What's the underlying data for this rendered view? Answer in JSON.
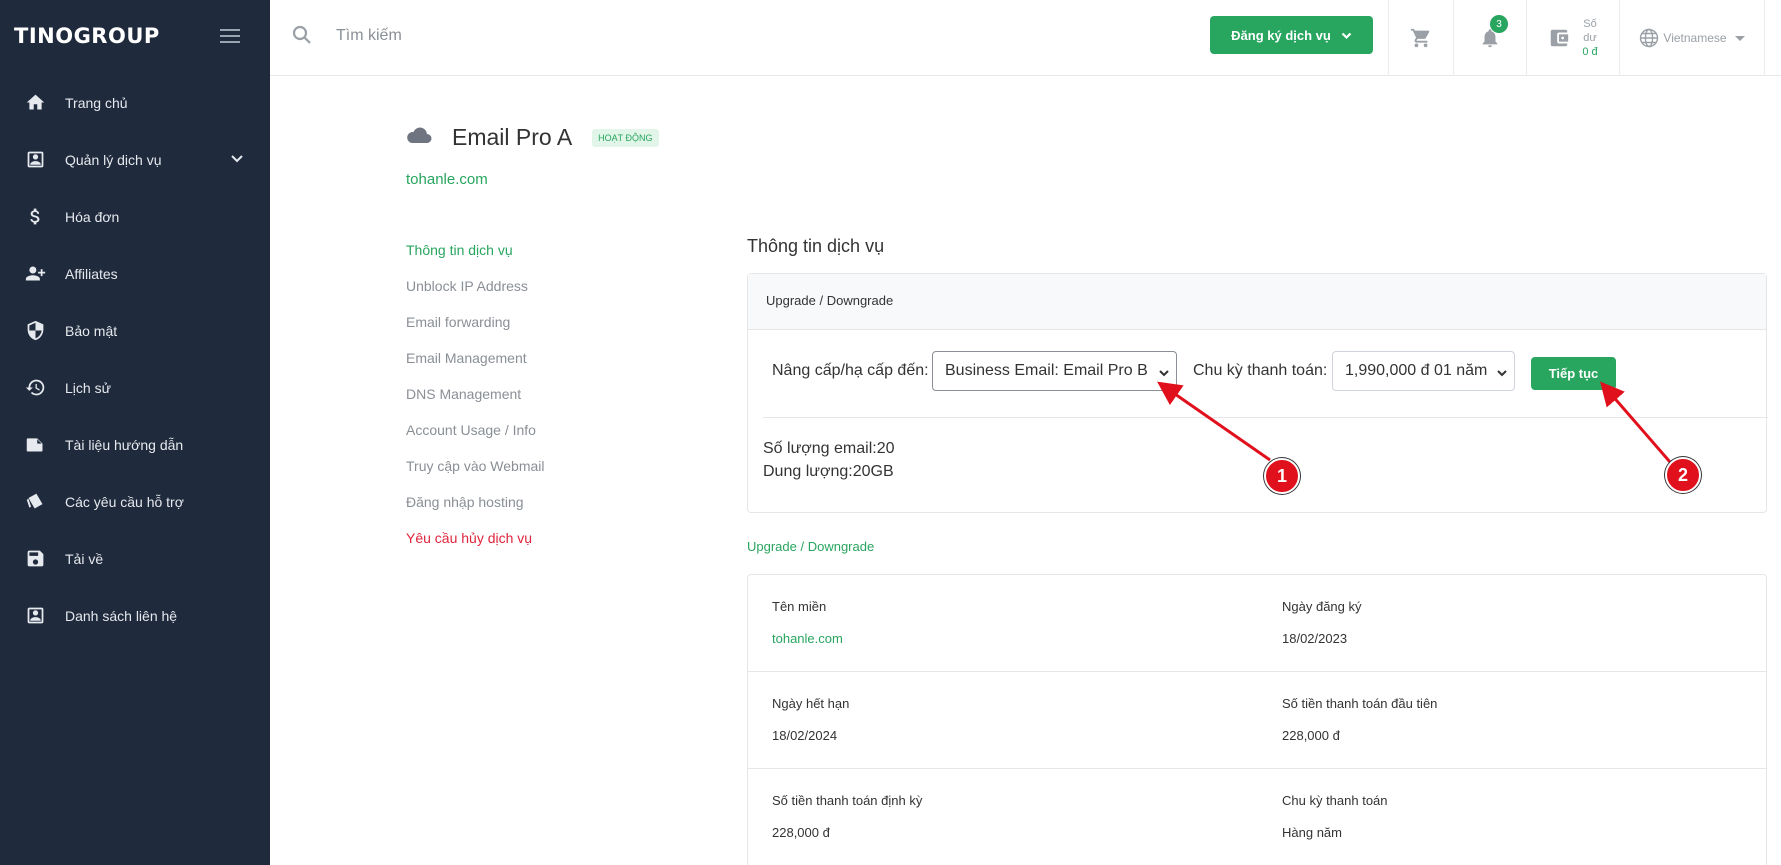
{
  "brand": {
    "logo_text": "TINOGROUP"
  },
  "sidebar": {
    "items": [
      {
        "label": "Trang chủ",
        "icon": "home-icon"
      },
      {
        "label": "Quản lý dịch vụ",
        "icon": "account-box-icon"
      },
      {
        "label": "Hóa đơn",
        "icon": "dollar-icon"
      },
      {
        "label": "Affiliates",
        "icon": "add-user-icon"
      },
      {
        "label": "Bảo mật",
        "icon": "shield-icon"
      },
      {
        "label": "Lịch sử",
        "icon": "history-icon"
      },
      {
        "label": "Tài liệu hướng dẫn",
        "icon": "folder-icon"
      },
      {
        "label": "Các yêu cầu hỗ trợ",
        "icon": "ticket-icon"
      },
      {
        "label": "Tải về",
        "icon": "save-icon"
      },
      {
        "label": "Danh sách liên hệ",
        "icon": "contact-icon"
      }
    ]
  },
  "header": {
    "search_placeholder": "Tìm kiếm",
    "register_label": "Đăng ký dịch vụ",
    "notification_count": "3",
    "balance_label_1": "Số",
    "balance_label_2": "dư",
    "balance_amount": "0 đ",
    "language": "Vietnamese"
  },
  "service": {
    "title": "Email Pro A",
    "status": "HOẠT ĐỘNG",
    "domain": "tohanle.com"
  },
  "subnav": [
    "Thông tin dịch vụ",
    "Unblock IP Address",
    "Email forwarding",
    "Email Management",
    "DNS Management",
    "Account Usage / Info",
    "Truy cập vào Webmail",
    "Đăng nhập hosting",
    "Yêu cầu hủy dịch vụ"
  ],
  "main": {
    "section_title": "Thông tin dịch vụ",
    "card_header": "Upgrade / Downgrade",
    "upgrade_label": "Nâng cấp/hạ cấp đến:",
    "upgrade_value": "Business Email: Email Pro B",
    "cycle_label": "Chu kỳ thanh toán:",
    "cycle_value": "1,990,000 đ 01 năm",
    "continue_label": "Tiếp tục",
    "info_line1": "Số lượng email:20",
    "info_line2": "Dung lượng:20GB",
    "link_label": "Upgrade / Downgrade"
  },
  "details": {
    "rows": [
      {
        "k1": "Tên miền",
        "v1": "tohanle.com",
        "k2": "Ngày đăng ký",
        "v2": "18/02/2023"
      },
      {
        "k1": "Ngày hết hạn",
        "v1": "18/02/2024",
        "k2": "Số tiền thanh toán đầu tiên",
        "v2": "228,000 đ"
      },
      {
        "k1": "Số tiền thanh toán định kỳ",
        "v1": "228,000 đ",
        "k2": "Chu kỳ thanh toán",
        "v2": "Hàng năm"
      }
    ]
  },
  "annotations": {
    "marker1": "1",
    "marker2": "2",
    "color": "#e0101c"
  },
  "colors": {
    "sidebar_bg": "#1f2a3c",
    "accent": "#28a55f",
    "danger": "#e0243c"
  }
}
